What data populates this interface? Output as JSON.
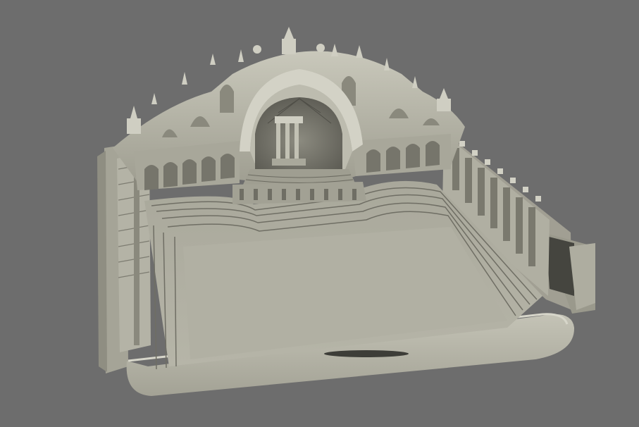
{
  "viewport": {
    "background_color": "#6d6d6d",
    "model_color": "#b9b8ab",
    "shadow_color": "#4a4a44",
    "highlight_color": "#dcdbd0"
  },
  "model": {
    "kind": "theater-stage-3d-model",
    "parts": [
      "stage-floor",
      "ornate-back-wall",
      "central-arch-niche",
      "left-side-wall",
      "right-side-colonnade",
      "front-apron"
    ]
  }
}
